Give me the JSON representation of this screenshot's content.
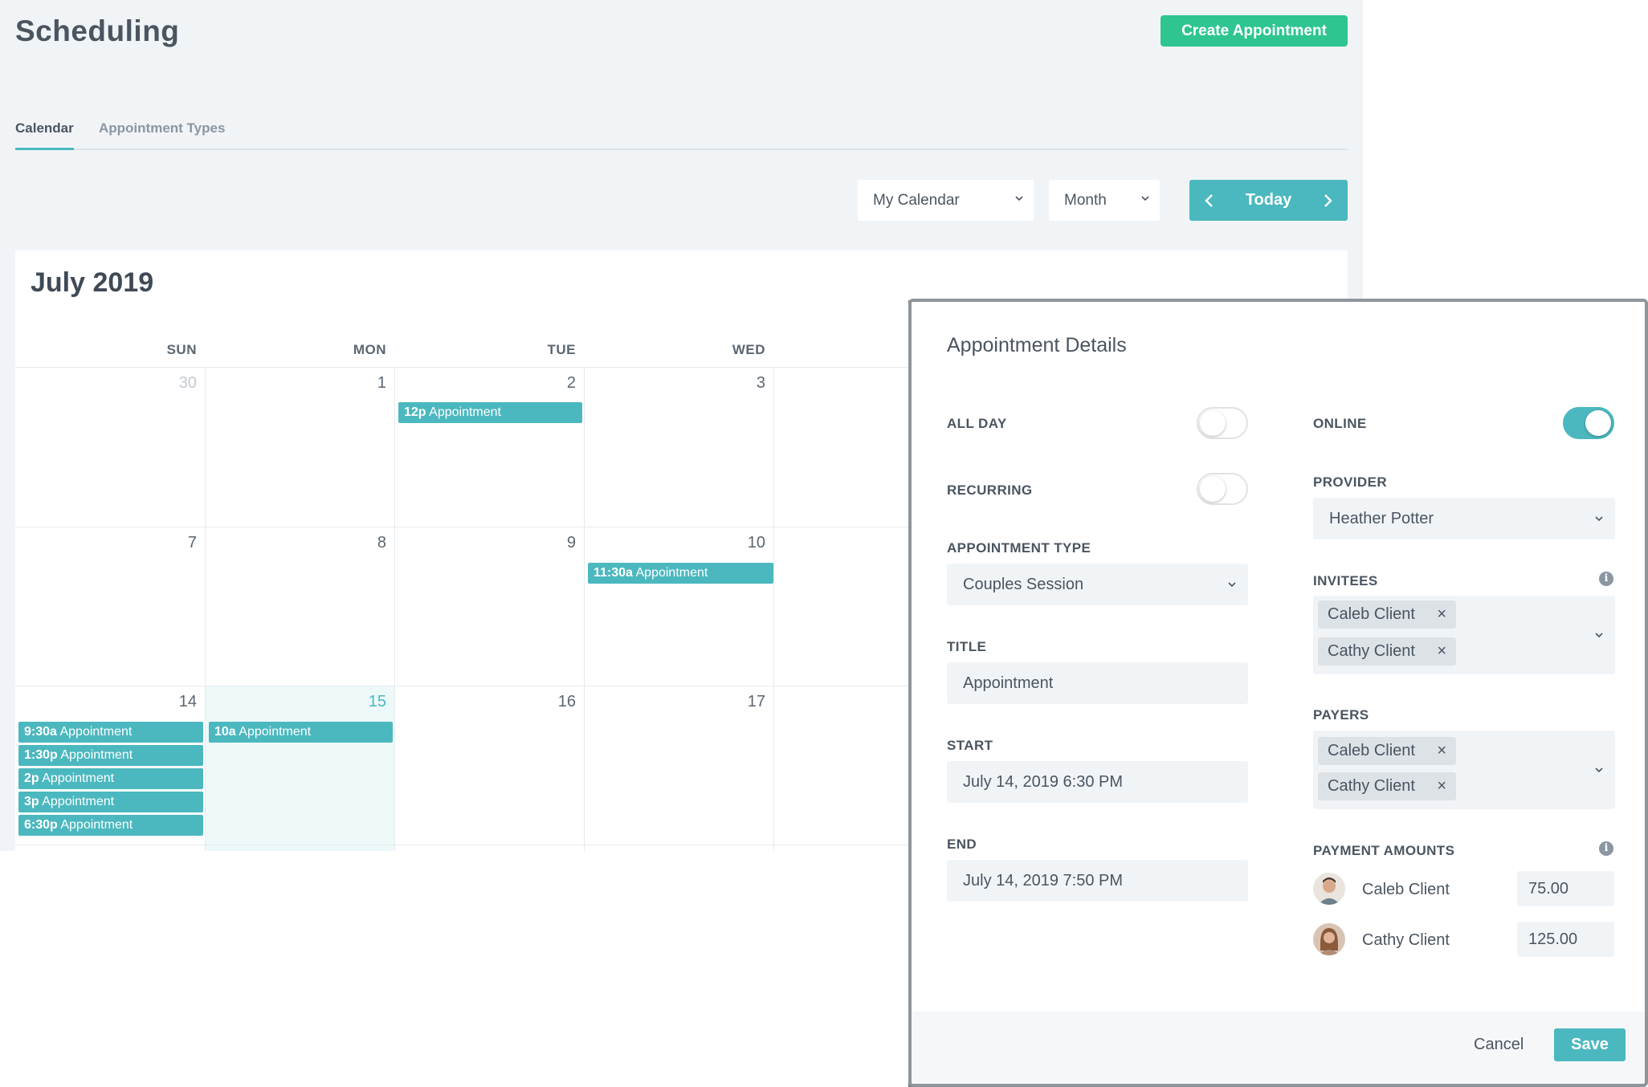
{
  "header": {
    "title": "Scheduling",
    "create_label": "Create Appointment"
  },
  "tabs": [
    {
      "label": "Calendar",
      "active": true
    },
    {
      "label": "Appointment Types",
      "active": false
    }
  ],
  "toolbar": {
    "calendar_select": "My Calendar",
    "view_select": "Month",
    "today_label": "Today"
  },
  "calendar": {
    "month_title": "July 2019",
    "weekdays": [
      "SUN",
      "MON",
      "TUE",
      "WED"
    ],
    "weeks": [
      {
        "days": [
          "30",
          "1",
          "2",
          "3"
        ]
      },
      {
        "days": [
          "7",
          "8",
          "9",
          "10"
        ]
      },
      {
        "days": [
          "14",
          "15",
          "16",
          "17"
        ]
      }
    ],
    "events": {
      "tue_2": {
        "time": "12p",
        "title": "Appointment"
      },
      "wed_10": {
        "time": "11:30a",
        "title": "Appointment"
      },
      "mon_15": {
        "time": "10a",
        "title": "Appointment"
      },
      "sun_14": [
        {
          "time": "9:30a",
          "title": "Appointment"
        },
        {
          "time": "1:30p",
          "title": "Appointment"
        },
        {
          "time": "2p",
          "title": "Appointment"
        },
        {
          "time": "3p",
          "title": "Appointment"
        },
        {
          "time": "6:30p",
          "title": "Appointment"
        }
      ]
    }
  },
  "modal": {
    "title": "Appointment Details",
    "all_day_label": "ALL DAY",
    "all_day": false,
    "recurring_label": "RECURRING",
    "recurring": false,
    "online_label": "ONLINE",
    "online": true,
    "appointment_type_label": "APPOINTMENT TYPE",
    "appointment_type": "Couples Session",
    "title_label": "TITLE",
    "title_value": "Appointment",
    "start_label": "START",
    "start_value": "July 14, 2019 6:30 PM",
    "end_label": "END",
    "end_value": "July 14, 2019 7:50 PM",
    "provider_label": "PROVIDER",
    "provider": "Heather Potter",
    "invitees_label": "INVITEES",
    "invitees": [
      "Caleb Client",
      "Cathy Client"
    ],
    "payers_label": "PAYERS",
    "payers": [
      "Caleb Client",
      "Cathy Client"
    ],
    "payment_amounts_label": "PAYMENT AMOUNTS",
    "payments": [
      {
        "name": "Caleb Client",
        "amount": "75.00"
      },
      {
        "name": "Cathy Client",
        "amount": "125.00"
      }
    ],
    "remove_glyph": "×",
    "info_glyph": "i",
    "cancel_label": "Cancel",
    "save_label": "Save"
  },
  "colors": {
    "accent": "#4bb8bf",
    "create_button": "#2ec590",
    "background": "#f1f4f7"
  },
  "icons": {
    "prev": "chevron-left-icon",
    "next": "chevron-right-icon",
    "dropdown": "chevron-down-icon",
    "remove": "close-icon",
    "info": "info-icon"
  }
}
